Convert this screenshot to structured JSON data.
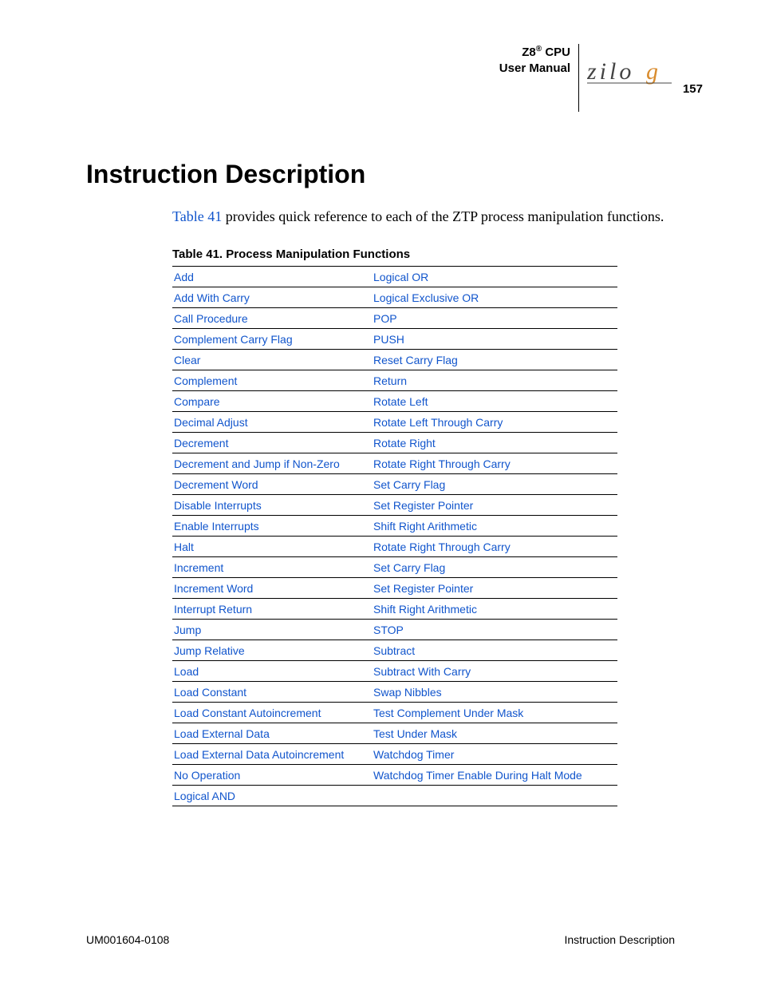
{
  "header": {
    "product_line1_pre": "Z8",
    "product_line1_sup": "®",
    "product_line1_post": " CPU",
    "product_line2": "User Manual",
    "page_number": "157"
  },
  "title": "Instruction Description",
  "intro": {
    "xref": "Table 41",
    "rest": " provides quick reference to each of the ZTP process manipulation functions."
  },
  "table": {
    "caption": "Table 41. Process Manipulation Functions",
    "rows": [
      {
        "left": "Add",
        "right": "Logical OR"
      },
      {
        "left": "Add With Carry",
        "right": "Logical Exclusive OR"
      },
      {
        "left": "Call Procedure",
        "right": "POP"
      },
      {
        "left": "Complement Carry Flag",
        "right": "PUSH"
      },
      {
        "left": "Clear",
        "right": "Reset Carry Flag"
      },
      {
        "left": "Complement",
        "right": "Return"
      },
      {
        "left": "Compare",
        "right": "Rotate Left"
      },
      {
        "left": "Decimal Adjust",
        "right": "Rotate Left Through Carry"
      },
      {
        "left": "Decrement",
        "right": "Rotate Right"
      },
      {
        "left": "Decrement and Jump if Non-Zero",
        "right": "Rotate Right Through Carry"
      },
      {
        "left": "Decrement Word",
        "right": "Set Carry Flag"
      },
      {
        "left": "Disable Interrupts",
        "right": "Set Register Pointer"
      },
      {
        "left": "Enable Interrupts",
        "right": "Shift Right Arithmetic"
      },
      {
        "left": "Halt",
        "right": "Rotate Right Through Carry"
      },
      {
        "left": "Increment",
        "right": "Set Carry Flag"
      },
      {
        "left": "Increment Word",
        "right": "Set Register Pointer"
      },
      {
        "left": "Interrupt Return",
        "right": "Shift Right Arithmetic"
      },
      {
        "left": "Jump",
        "right": "STOP"
      },
      {
        "left": "Jump Relative",
        "right": "Subtract"
      },
      {
        "left": "Load",
        "right": "Subtract With Carry"
      },
      {
        "left": "Load Constant",
        "right": "Swap Nibbles"
      },
      {
        "left": "Load Constant Autoincrement",
        "right": "Test Complement Under Mask"
      },
      {
        "left": "Load External Data",
        "right": "Test Under Mask"
      },
      {
        "left": "Load External Data Autoincrement",
        "right": "Watchdog Timer"
      },
      {
        "left": "No Operation",
        "right": "Watchdog Timer Enable During Halt Mode"
      },
      {
        "left": "Logical AND",
        "right": ""
      }
    ]
  },
  "footer": {
    "doc_id": "UM001604-0108",
    "section": "Instruction Description"
  }
}
